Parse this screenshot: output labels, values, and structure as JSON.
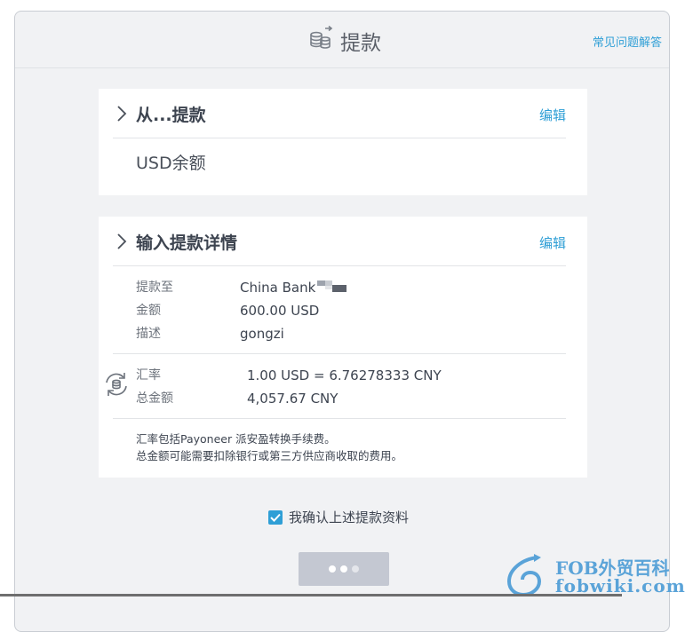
{
  "header": {
    "title": "提款",
    "faq_label": "常见问题解答"
  },
  "from_section": {
    "title": "从...提款",
    "edit_label": "编辑",
    "balance": "USD余额"
  },
  "details_section": {
    "title": "输入提款详情",
    "edit_label": "编辑",
    "rows": [
      {
        "label": "提款至",
        "value": "China Bank"
      },
      {
        "label": "金额",
        "value": "600.00 USD"
      },
      {
        "label": "描述",
        "value": "gongzi"
      }
    ],
    "rate_label": "汇率",
    "rate_value": "1.00 USD = 6.76278333 CNY",
    "total_label": "总金额",
    "total_value": "4,057.67 CNY",
    "note_line1": "汇率包括Payoneer 派安盈转换手续费。",
    "note_line2": "总金额可能需要扣除银行或第三方供应商收取的费用。"
  },
  "confirm": {
    "label": "我确认上述提款资料",
    "checked": true
  },
  "watermark": {
    "line1": "FOB外贸百科",
    "line2": "fobwiki.com"
  },
  "colors": {
    "accent": "#2f9fd6",
    "background": "#f1f2f4",
    "button_disabled": "#c4c8d2"
  }
}
